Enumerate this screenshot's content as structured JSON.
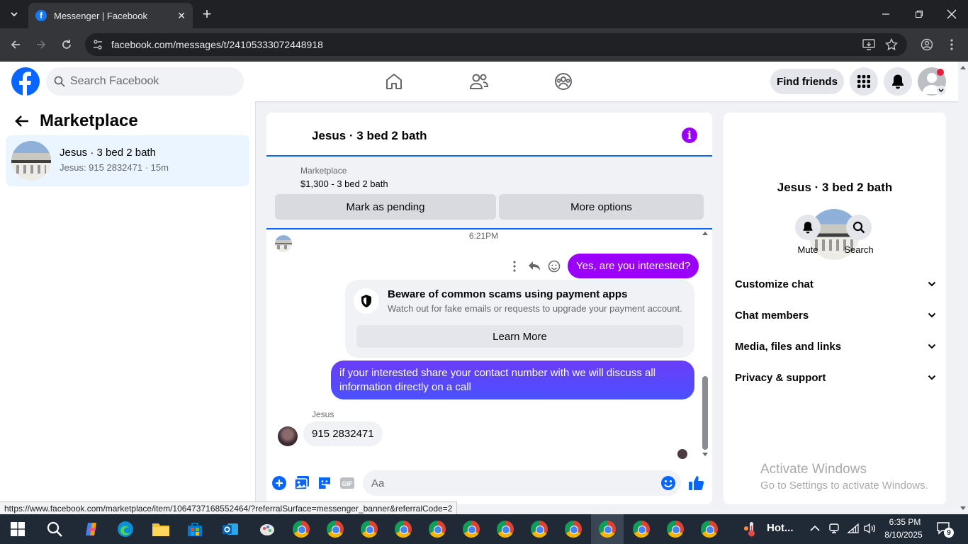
{
  "browser": {
    "tab_title": "Messenger | Facebook",
    "url": "facebook.com/messages/t/24105333072448918",
    "status_url": "https://www.facebook.com/marketplace/item/1064737168552464/?referralSurface=messenger_banner&referralCode=2"
  },
  "fb_header": {
    "search_placeholder": "Search Facebook",
    "find_friends_label": "Find friends"
  },
  "left_panel": {
    "title": "Marketplace",
    "conversations": [
      {
        "name": "Jesus · 3 bed 2 bath",
        "preview": "Jesus: 915 2832471 · 15m"
      }
    ]
  },
  "chat": {
    "title": "Jesus · 3 bed 2 bath",
    "listing": {
      "source": "Marketplace",
      "price_title": "$1,300 - 3 bed 2 bath",
      "mark_pending_label": "Mark as pending",
      "more_options_label": "More options"
    },
    "timestamp": "6:21PM",
    "messages": [
      {
        "from": "me",
        "text": "Yes, are you interested?"
      },
      {
        "from": "me",
        "text": "if your interested share your contact number with we will discuss all information directly on a call"
      },
      {
        "from": "Jesus",
        "text": "915 2832471"
      }
    ],
    "scam_warning": {
      "title": "Beware of common scams using payment apps",
      "description": "Watch out for fake emails or requests to upgrade your payment account.",
      "button_label": "Learn More"
    },
    "sender_label": "Jesus",
    "composer_placeholder": "Aa",
    "accent_color": "#9b00fa"
  },
  "right_panel": {
    "name": "Jesus · 3 bed 2 bath",
    "actions": [
      {
        "label": "Mute"
      },
      {
        "label": "Search"
      }
    ],
    "sections": [
      {
        "label": "Customize chat"
      },
      {
        "label": "Chat members"
      },
      {
        "label": "Media, files and links"
      },
      {
        "label": "Privacy & support"
      }
    ]
  },
  "windows_watermark": {
    "line1": "Activate Windows",
    "line2": "Go to Settings to activate Windows."
  },
  "taskbar": {
    "weather": "Hot...",
    "time": "6:35 PM",
    "date": "8/10/2025",
    "notification_count": "9"
  }
}
